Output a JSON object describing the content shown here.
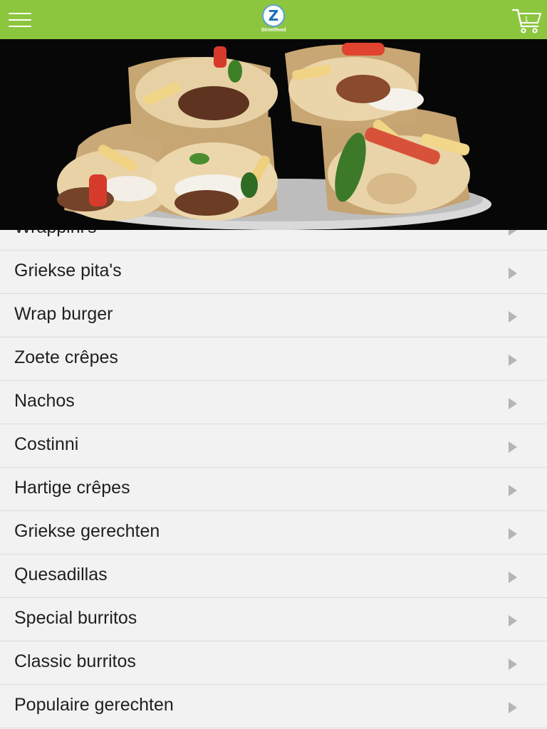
{
  "header": {
    "menu_icon": "hamburger-menu-icon",
    "logo_letter": "Z",
    "logo_text": "Streetfood",
    "cart_icon": "shopping-cart-icon",
    "cart_count": "1",
    "background_color": "#8cc63f"
  },
  "hero": {
    "image": "food-wraps-photo"
  },
  "categories": [
    {
      "label": "Wrappini's"
    },
    {
      "label": "Griekse pita's"
    },
    {
      "label": "Wrap burger"
    },
    {
      "label": "Zoete crêpes"
    },
    {
      "label": "Nachos"
    },
    {
      "label": "Costinni"
    },
    {
      "label": "Hartige crêpes"
    },
    {
      "label": "Griekse gerechten"
    },
    {
      "label": "Quesadillas"
    },
    {
      "label": "Special burritos"
    },
    {
      "label": "Classic burritos"
    },
    {
      "label": "Populaire gerechten"
    }
  ]
}
